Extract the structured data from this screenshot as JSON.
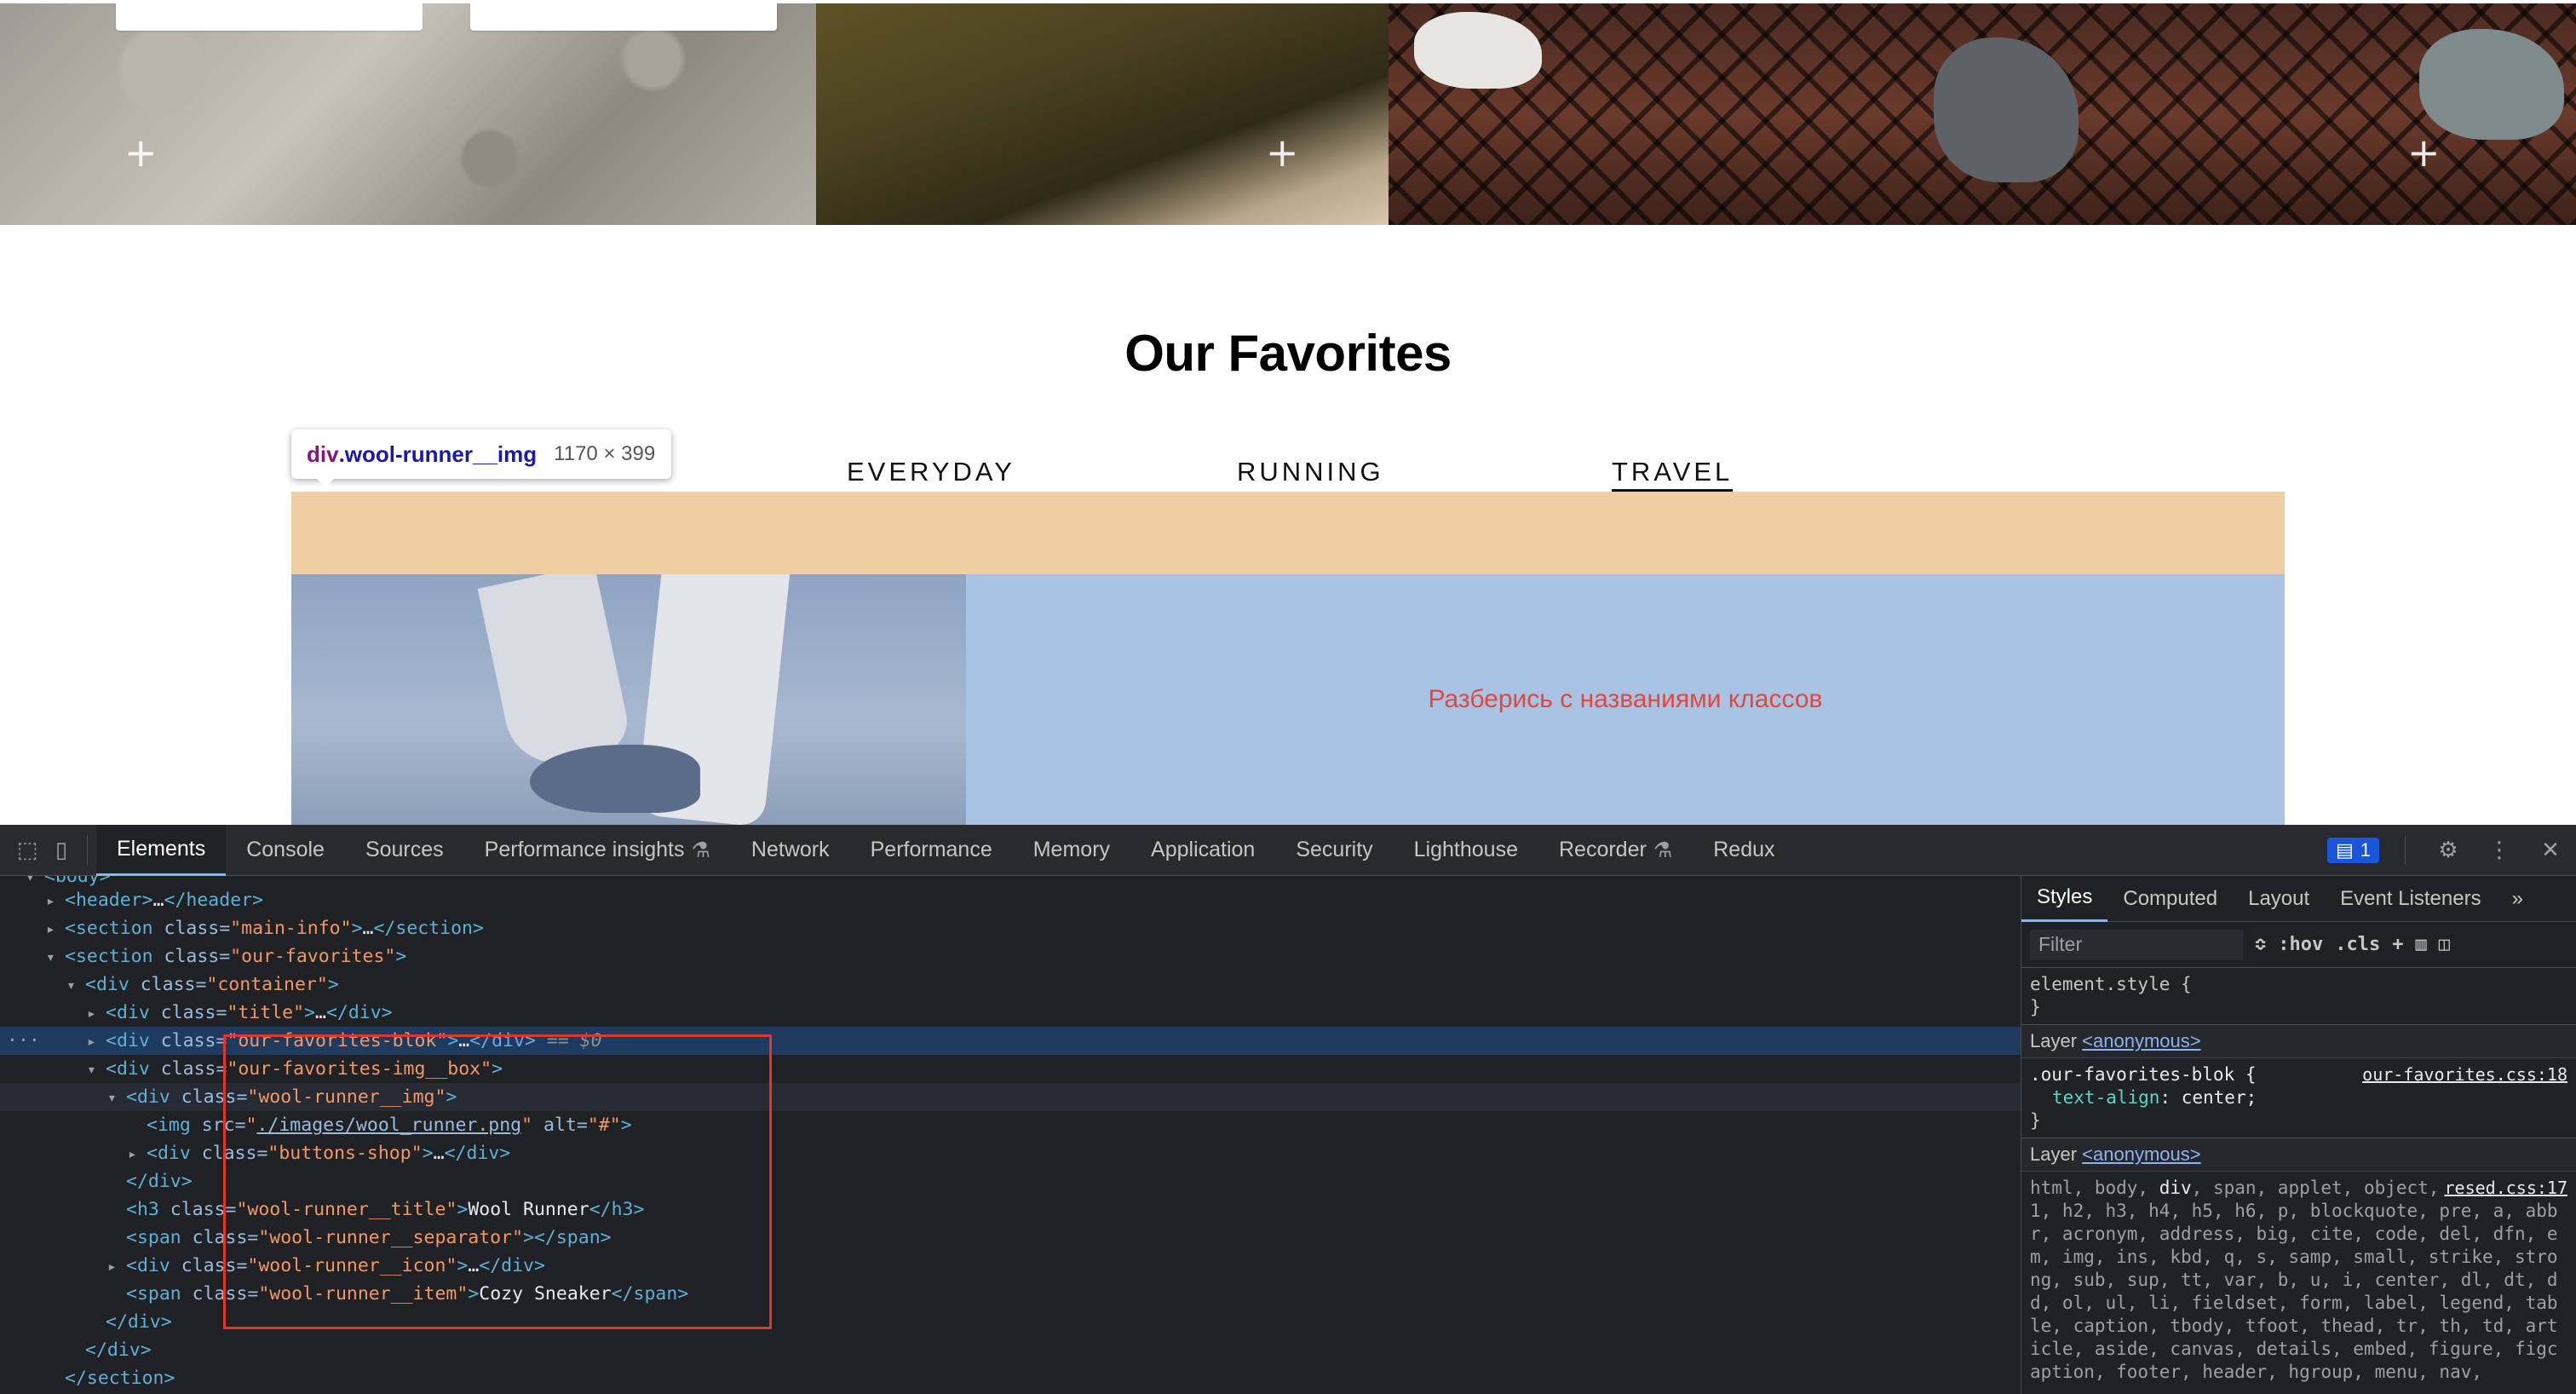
{
  "page": {
    "section_title": "Our Favorites",
    "tabs": [
      {
        "label": "EVERYDAY",
        "active": false
      },
      {
        "label": "RUNNING",
        "active": false
      },
      {
        "label": "TRAVEL",
        "active": true
      }
    ],
    "overlay_message": "Разберись с названиями классов",
    "colors": {
      "overlay_orange": "#f0cea3",
      "overlay_blue": "#a8c3e4",
      "message_red": "#e2483c"
    }
  },
  "tooltip": {
    "tag": "div",
    "class": ".wool-runner__img",
    "size": "1170 × 399"
  },
  "devtools": {
    "tabs": [
      "Elements",
      "Console",
      "Sources",
      "Performance insights",
      "Network",
      "Performance",
      "Memory",
      "Application",
      "Security",
      "Lighthouse",
      "Recorder",
      "Redux"
    ],
    "active_tab": "Elements",
    "issues_count": "1",
    "icons": {
      "inspect": "inspect-element-icon",
      "device": "device-toolbar-icon",
      "settings": "gear-icon",
      "menu": "kebab-menu-icon",
      "close": "close-icon",
      "flask": "experiment-flask-icon"
    },
    "dom": {
      "body_partial": "<body>",
      "header_tag": "header",
      "section_main_class": "main-info",
      "section_fav_class": "our-favorites",
      "container_class": "container",
      "title_class": "title",
      "blok_class": "our-favorites-blok",
      "selected_marker": "== $0",
      "img_box_class": "our-favorites-img__box",
      "wool_img_class": "wool-runner__img",
      "img_src": "./images/wool_runner.png",
      "img_alt": "#",
      "buttons_class": "buttons-shop",
      "h3_class": "wool-runner__title",
      "h3_text": "Wool Runner",
      "separator_class": "wool-runner__separator",
      "icon_class": "wool-runner__icon",
      "item_class": "wool-runner__item",
      "item_text": "Cozy Sneaker",
      "ellipsis": "…",
      "section_close": "</section>"
    },
    "styles": {
      "tabs": [
        "Styles",
        "Computed",
        "Layout",
        "Event Listeners"
      ],
      "active_tab": "Styles",
      "filter_placeholder": "Filter",
      "hov": ":hov",
      "cls": ".cls",
      "element_style": "element.style {",
      "close_brace": "}",
      "layer_label": "Layer",
      "layer_name": "<anonymous>",
      "rule1_selector": ".our-favorites-blok {",
      "rule1_source": "our-favorites.css:18",
      "rule1_prop": "text-align",
      "rule1_value": ": center;",
      "rule2_source": "resed.css:17",
      "rule2_selectors_lead": "html, body, ",
      "rule2_selectors_bold": "div",
      "rule2_selectors_rest": ", span, applet, object, iframe, h1, h2, h3, h4, h5, h6, p, blockquote, pre, a, abbr, acronym, address, big, cite, code, del, dfn, em, img, ins, kbd, q, s, samp, small, strike, strong, sub, sup, tt, var, b, u, i, center, dl, dt, dd, ol, ul, li, fieldset, form, label, legend, table, caption, tbody, tfoot, thead, tr, th, td, article, aside, canvas, details, embed, figure, figcaption, footer, header, hgroup, menu, nav,"
    }
  }
}
